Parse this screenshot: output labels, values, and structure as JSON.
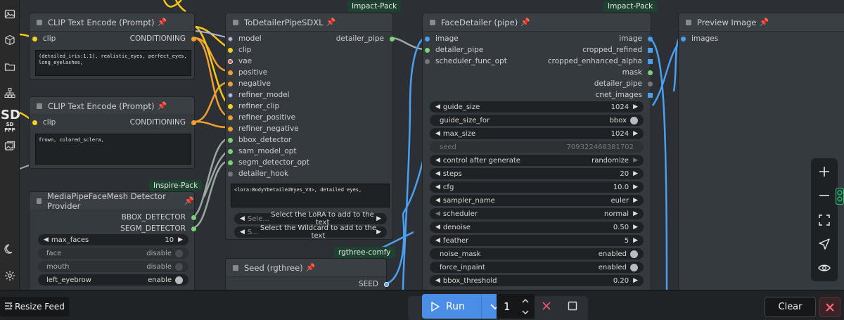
{
  "sidebar": {
    "logo_big": "SD",
    "logo_small": "SD PPP"
  },
  "badges": {
    "impact_pack_1": "Impact-Pack",
    "impact_pack_2": "Impact-Pack",
    "inspire_pack": "Inspire-Pack",
    "rgthree": "rgthree-comfy"
  },
  "clip_encode_1": {
    "title": "CLIP Text Encode (Prompt)",
    "input": "clip",
    "output": "CONDITIONING",
    "text": "(detailed_iris:1.1), realistic_eyes, perfect_eyes, long_eyelashes,"
  },
  "clip_encode_2": {
    "title": "CLIP Text Encode (Prompt)",
    "input": "clip",
    "output": "CONDITIONING",
    "text": "frown, colored_sclera,"
  },
  "mediapipe": {
    "title": "MediaPipeFaceMesh Detector Provider",
    "outputs": [
      "BBOX_DETECTOR",
      "SEGM_DETECTOR"
    ],
    "widgets": [
      {
        "label": "max_faces",
        "value": "10"
      },
      {
        "label": "face",
        "value": "disable"
      },
      {
        "label": "mouth",
        "value": "disable"
      },
      {
        "label": "left_eyebrow",
        "value": "enable"
      }
    ]
  },
  "detailer_pipe": {
    "title": "ToDetailerPipeSDXL",
    "inputs": [
      "model",
      "clip",
      "vae",
      "positive",
      "negative",
      "refiner_model",
      "refiner_clip",
      "refiner_positive",
      "refiner_negative",
      "bbox_detector",
      "sam_model_opt",
      "segm_detector_opt",
      "detailer_hook"
    ],
    "output": "detailer_pipe",
    "text": "<lora:BodyYDetailedEyes_V3>, detailed eyes,",
    "lora_btn_prefix": "Sele...",
    "lora_btn": "Select the LoRA to add to the text",
    "wildcard_btn_prefix": "S...",
    "wildcard_btn": "Select the Wildcard to add to the text"
  },
  "seed_node": {
    "title": "Seed (rgthree)",
    "output": "SEED"
  },
  "face_detailer": {
    "title": "FaceDetailer (pipe)",
    "inputs": [
      "image",
      "detailer_pipe",
      "scheduler_func_opt"
    ],
    "outputs": [
      "image",
      "cropped_refined",
      "cropped_enhanced_alpha",
      "mask",
      "detailer_pipe",
      "cnet_images"
    ],
    "widgets": [
      {
        "label": "guide_size",
        "value": "1024"
      },
      {
        "label": "guide_size_for",
        "value": "bbox"
      },
      {
        "label": "max_size",
        "value": "1024"
      },
      {
        "label": "seed",
        "value": "709322468381702"
      },
      {
        "label": "control after generate",
        "value": "randomize"
      },
      {
        "label": "steps",
        "value": "20"
      },
      {
        "label": "cfg",
        "value": "10.0"
      },
      {
        "label": "sampler_name",
        "value": "euler"
      },
      {
        "label": "scheduler",
        "value": "normal"
      },
      {
        "label": "denoise",
        "value": "0.50"
      },
      {
        "label": "feather",
        "value": "5"
      },
      {
        "label": "noise_mask",
        "value": "enabled"
      },
      {
        "label": "force_inpaint",
        "value": "enabled"
      },
      {
        "label": "bbox_threshold",
        "value": "0.20"
      }
    ]
  },
  "preview": {
    "title": "Preview Image",
    "input": "images"
  },
  "bottombar": {
    "resize_feed": "Resize Feed",
    "run": "Run",
    "quantity": "1",
    "clear": "Clear"
  },
  "colors": {
    "badge_bg": "#1d4230",
    "run_blue": "#4a8ee8",
    "wire_yellow": "#f5c518",
    "wire_orange": "#f0a030",
    "wire_blue": "#4aa0f0",
    "wire_gray": "#9aa8a0"
  }
}
